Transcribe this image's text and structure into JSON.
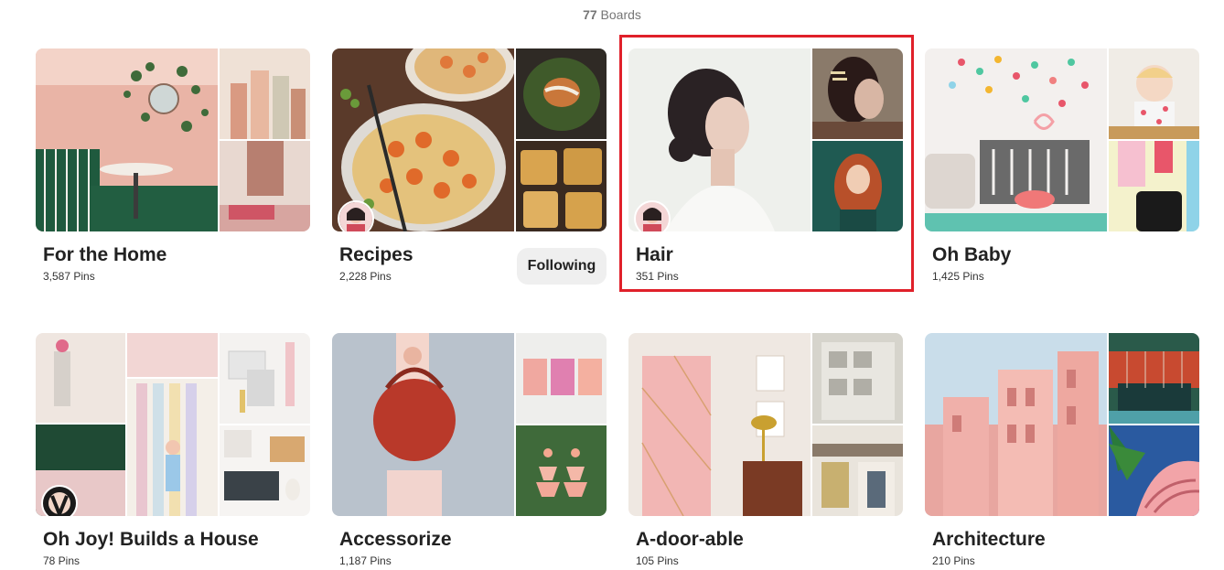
{
  "header": {
    "count": "77",
    "label": "Boards"
  },
  "boards": [
    {
      "title": "For the Home",
      "pins": "3,587 Pins"
    },
    {
      "title": "Recipes",
      "pins": "2,228 Pins",
      "button": "Following"
    },
    {
      "title": "Hair",
      "pins": "351 Pins"
    },
    {
      "title": "Oh Baby",
      "pins": "1,425 Pins"
    },
    {
      "title": "Oh Joy! Builds a House",
      "pins": "78 Pins"
    },
    {
      "title": "Accessorize",
      "pins": "1,187 Pins"
    },
    {
      "title": "A-door-able",
      "pins": "105 Pins"
    },
    {
      "title": "Architecture",
      "pins": "210 Pins"
    }
  ],
  "colors": {
    "highlight": "#e0202a",
    "button_bg": "#efefef",
    "muted_text": "#767676"
  }
}
